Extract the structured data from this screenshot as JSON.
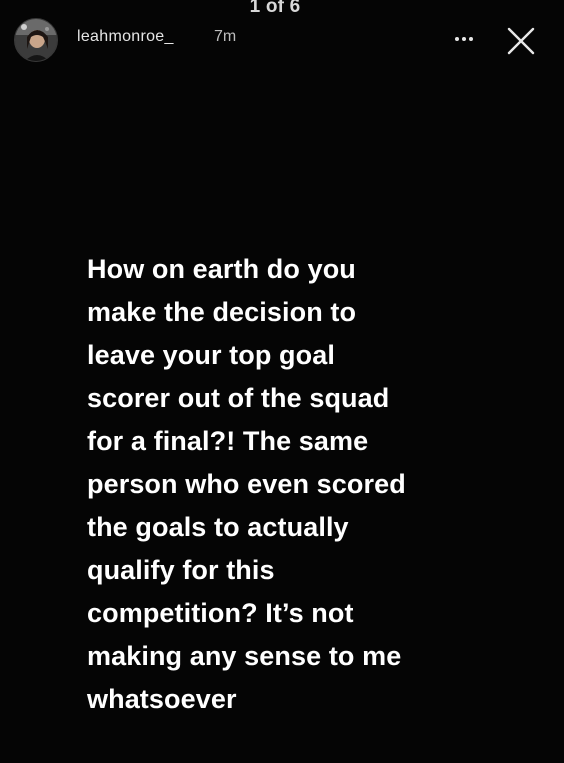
{
  "story": {
    "counter": "1 of 6",
    "author": {
      "username": "leahmonroe_",
      "posted_ago": "7m"
    },
    "text_lines": [
      "How on earth do you",
      "make the decision to",
      "leave your top goal",
      "scorer out of the squad",
      "for a final?! The same",
      "person who even scored",
      "the goals to actually",
      "qualify for this",
      "competition? It’s not",
      "making any sense to me",
      "whatsoever"
    ]
  },
  "icons": {
    "more": "more-horizontal-icon",
    "close": "close-icon",
    "avatar": "profile-picture"
  },
  "colors": {
    "background": "#050505",
    "text": "#ffffff",
    "muted": "#bdbdbd"
  }
}
